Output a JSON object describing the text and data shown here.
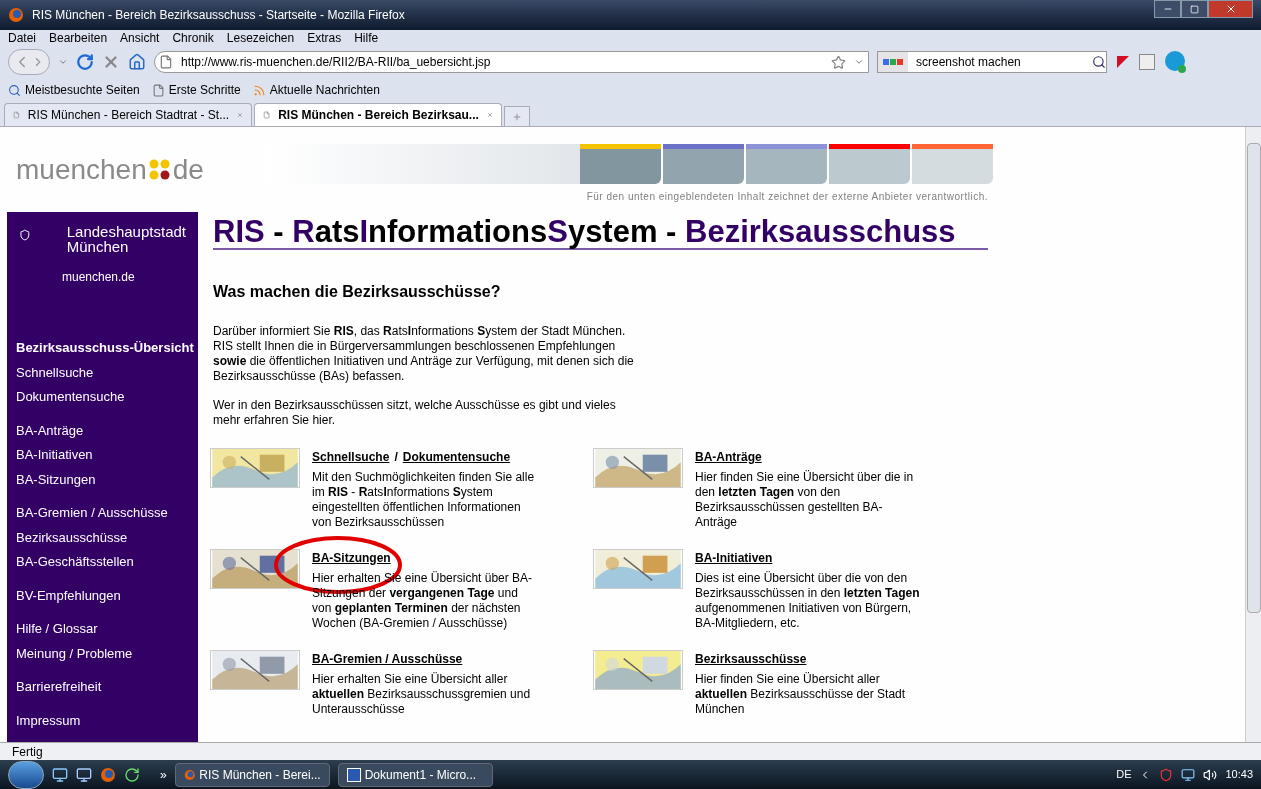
{
  "window": {
    "title": "RIS München - Bereich Bezirksausschuss - Startseite - Mozilla Firefox"
  },
  "menu": [
    "Datei",
    "Bearbeiten",
    "Ansicht",
    "Chronik",
    "Lesezeichen",
    "Extras",
    "Hilfe"
  ],
  "address": {
    "value": "http://www.ris-muenchen.de/RII2/BA-RII/ba_uebersicht.jsp"
  },
  "search": {
    "value": "screenshot machen"
  },
  "bookmarks": [
    {
      "kind": "star",
      "label": "Meistbesuchte Seiten"
    },
    {
      "kind": "page",
      "label": "Erste Schritte"
    },
    {
      "kind": "feed",
      "label": "Aktuelle Nachrichten"
    }
  ],
  "tabs": [
    {
      "label": "RIS München - Bereich Stadtrat - St...",
      "selected": false
    },
    {
      "label": "RIS München - Bereich Bezirksau...",
      "selected": true
    }
  ],
  "page": {
    "logo": {
      "left": "muenchen",
      "right": "de"
    },
    "header_tabs": [
      {
        "color": "#f5c400"
      },
      {
        "color": "#6b72c8"
      },
      {
        "color": "#8c93d6"
      },
      {
        "color": "#ff0000"
      },
      {
        "color": "#ff6633"
      }
    ],
    "disclaimer": "Für den unten eingeblendeten Inhalt zeichnet der externe Anbieter verantwortlich.",
    "sidebar": {
      "city": "Landeshauptstadt München",
      "link": "muenchen.de",
      "groups": [
        [
          {
            "label": "Bezirksausschuss-Übersicht",
            "selected": true
          },
          {
            "label": "Schnellsuche",
            "selected": false
          },
          {
            "label": "Dokumentensuche",
            "selected": false
          }
        ],
        [
          {
            "label": "BA-Anträge",
            "selected": false
          },
          {
            "label": "BA-Initiativen",
            "selected": false
          },
          {
            "label": "BA-Sitzungen",
            "selected": false
          }
        ],
        [
          {
            "label": "BA-Gremien / Ausschüsse",
            "selected": false
          },
          {
            "label": "Bezirksausschüsse",
            "selected": false
          },
          {
            "label": "BA-Geschäftsstellen",
            "selected": false
          }
        ],
        [
          {
            "label": "BV-Empfehlungen",
            "selected": false
          }
        ],
        [
          {
            "label": "Hilfe / Glossar",
            "selected": false
          },
          {
            "label": "Meinung / Probleme",
            "selected": false
          }
        ],
        [
          {
            "label": "Barrierefreiheit",
            "selected": false
          }
        ],
        [
          {
            "label": "Impressum",
            "selected": false
          }
        ]
      ]
    },
    "title": [
      {
        "text": "RIS",
        "accent": true
      },
      {
        "text": " - ",
        "accent": false
      },
      {
        "text": "R",
        "accent": true
      },
      {
        "text": "ats",
        "accent": false
      },
      {
        "text": "I",
        "accent": true
      },
      {
        "text": "nformations",
        "accent": false
      },
      {
        "text": "S",
        "accent": true
      },
      {
        "text": "ystem - ",
        "accent": false
      },
      {
        "text": "Bezirksausschuss",
        "accent": true
      }
    ],
    "heading": "Was machen die Bezirksausschüsse?",
    "paragraphs": [
      "Darüber informiert Sie **RIS**, das **R**ats**I**nformations **S**ystem der Stadt München. RIS stellt Ihnen die in Bürgerversammlungen beschlossenen Empfehlungen **sowie** die öffentlichen Initiativen und Anträge zur Verfügung, mit denen sich die Bezirksausschüsse (BAs) befassen.",
      "Wer in den Bezirksausschüssen sitzt, welche Ausschüsse es gibt und vieles mehr erfahren Sie hier."
    ],
    "cards": [
      {
        "links": [
          "Schnellsuche",
          "Dokumentensuche"
        ],
        "separator": "/",
        "text": "Mit den Suchmöglichkeiten finden Sie alle im **RIS** - **R**ats**I**nformations **S**ystem eingestellten öffentlichen Informationen von Bezirksausschüssen"
      },
      {
        "links": [
          "BA-Anträge"
        ],
        "text": "Hier finden Sie eine Übersicht über die in den **letzten Tagen** von den Bezirksausschüssen gestellten BA-Anträge"
      },
      {
        "links": [
          "BA-Sitzungen"
        ],
        "circled": true,
        "text": "Hier erhalten Sie eine Übersicht über BA-Sitzungen der **vergangenen Tage** und von **geplanten Terminen** der nächsten Wochen (BA-Gremien / Ausschüsse)"
      },
      {
        "links": [
          "BA-Initiativen"
        ],
        "text": "Dies ist eine Übersicht über die von den Bezirksausschüssen in den **letzten Tagen** aufgenommenen Initiativen von Bürgern, BA-Mitgliedern, etc."
      },
      {
        "links": [
          "BA-Gremien / Ausschüsse"
        ],
        "text": "Hier erhalten Sie eine Übersicht aller **aktuellen** Bezirksausschussgremien und Unterausschüsse"
      },
      {
        "links": [
          "Bezirksausschüsse"
        ],
        "text": "Hier finden Sie eine Übersicht aller **aktuellen** Bezirksausschüsse der Stadt München"
      }
    ]
  },
  "status_bar": "Fertig",
  "taskbar": {
    "more": "»",
    "tasks": [
      {
        "kind": "firefox",
        "label": "RIS München - Berei..."
      },
      {
        "kind": "word",
        "label": "Dokument1 - Micro..."
      }
    ],
    "language": "DE",
    "clock": "10:43"
  }
}
